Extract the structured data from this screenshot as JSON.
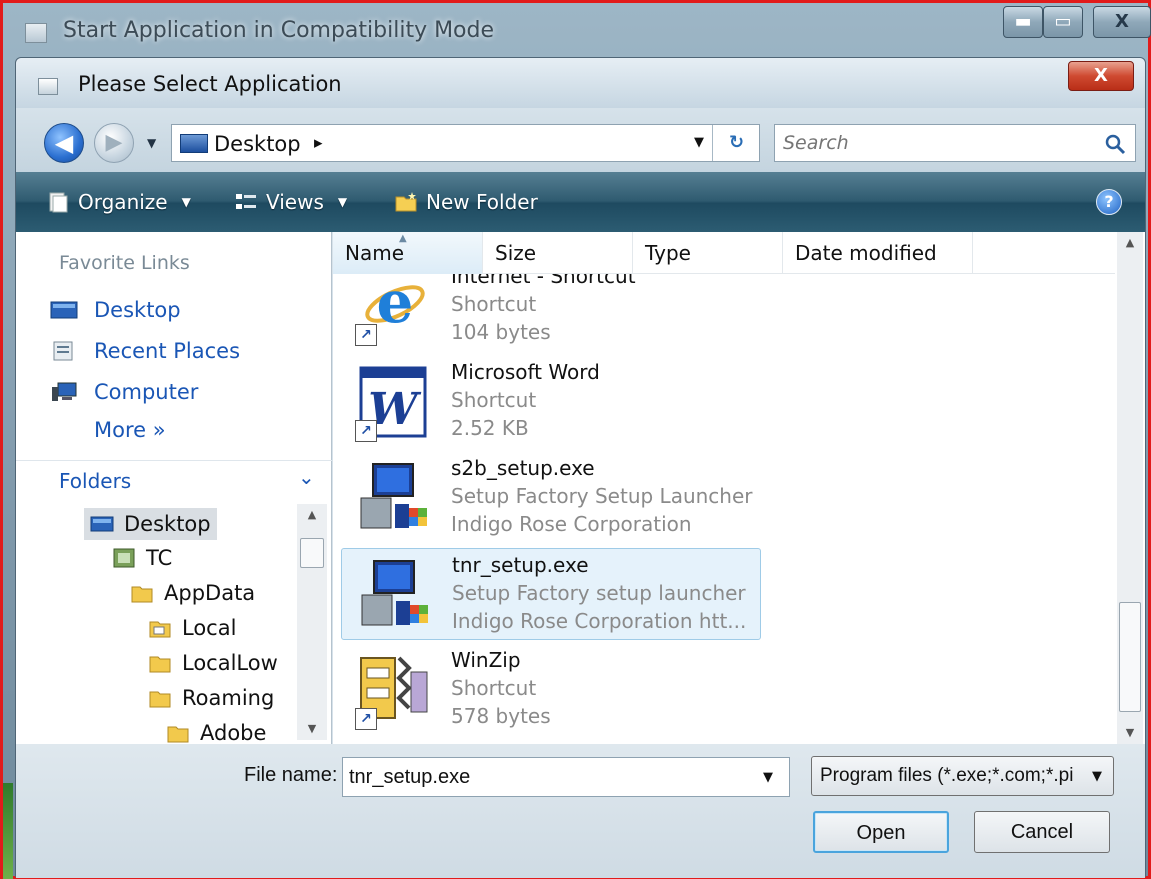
{
  "outer_window": {
    "title": "Start Application in Compatibility Mode",
    "minimize": "▬",
    "maximize": "▭",
    "close": "X"
  },
  "dialog": {
    "title": "Please Select Application",
    "close": "X"
  },
  "navbar": {
    "back": "◀",
    "forward": "▶",
    "address": "Desktop",
    "address_separator": "▸",
    "refresh": "↻",
    "search_placeholder": "Search"
  },
  "toolbar": {
    "organize": "Organize",
    "views": "Views",
    "new_folder": "New Folder",
    "help": "?"
  },
  "nav_pane": {
    "favorites_header": "Favorite Links",
    "favorites": [
      {
        "label": "Desktop",
        "icon": "desktop-icon"
      },
      {
        "label": "Recent Places",
        "icon": "recent-places-icon"
      },
      {
        "label": "Computer",
        "icon": "computer-icon"
      }
    ],
    "more": "More »",
    "folders_header": "Folders",
    "tree": [
      {
        "label": "Desktop",
        "level": 0,
        "selected": true
      },
      {
        "label": "TC",
        "level": 1
      },
      {
        "label": "AppData",
        "level": 2
      },
      {
        "label": "Local",
        "level": 3
      },
      {
        "label": "LocalLow",
        "level": 3
      },
      {
        "label": "Roaming",
        "level": 3
      },
      {
        "label": "Adobe",
        "level": 4
      }
    ]
  },
  "file_pane": {
    "columns": [
      "Name",
      "Size",
      "Type",
      "Date modified"
    ],
    "files": [
      {
        "name": "Internet - Shortcut",
        "line2": "Shortcut",
        "line3": "104 bytes",
        "icon": "internet-explorer-icon"
      },
      {
        "name": "Microsoft Word",
        "line2": "Shortcut",
        "line3": "2.52 KB",
        "icon": "word-icon"
      },
      {
        "name": "s2b_setup.exe",
        "line2": "Setup Factory Setup Launcher",
        "line3": "Indigo Rose Corporation",
        "icon": "setup-launcher-icon"
      },
      {
        "name": "tnr_setup.exe",
        "line2": "Setup Factory setup launcher",
        "line3": "Indigo Rose Corporation htt...",
        "icon": "setup-launcher-icon",
        "selected": true
      },
      {
        "name": "WinZip",
        "line2": "Shortcut",
        "line3": "578 bytes",
        "icon": "winzip-icon"
      }
    ]
  },
  "bottom": {
    "file_name_label": "File name:",
    "file_name_value": "tnr_setup.exe",
    "filter": "Program files (*.exe;*.com;*.pi",
    "open": "Open",
    "cancel": "Cancel"
  }
}
